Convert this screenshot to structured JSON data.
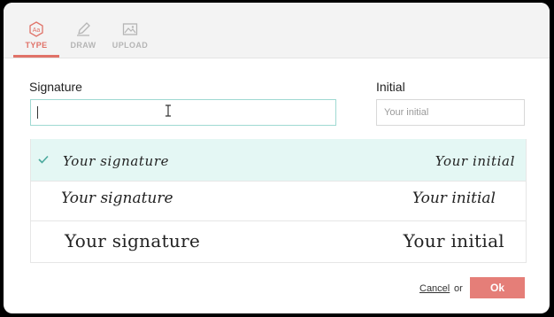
{
  "tabs": [
    {
      "label": "TYPE",
      "icon": "type-icon",
      "active": true
    },
    {
      "label": "DRAW",
      "icon": "pen-icon",
      "active": false
    },
    {
      "label": "UPLOAD",
      "icon": "image-icon",
      "active": false
    }
  ],
  "form": {
    "signature_label": "Signature",
    "signature_value": "",
    "initial_label": "Initial",
    "initial_placeholder": "Your initial"
  },
  "options": [
    {
      "signature": "Your signature",
      "initial": "Your initial",
      "selected": true
    },
    {
      "signature": "Your signature",
      "initial": "Your initial",
      "selected": false
    },
    {
      "signature": "Your signature",
      "initial": "Your initial",
      "selected": false
    }
  ],
  "footer": {
    "cancel_label": "Cancel",
    "or_label": "or",
    "ok_label": "Ok"
  },
  "colors": {
    "accent": "#e07268",
    "selected_row": "#e4f7f4",
    "check": "#4aa99d",
    "input_focus": "#9fd9d2"
  }
}
